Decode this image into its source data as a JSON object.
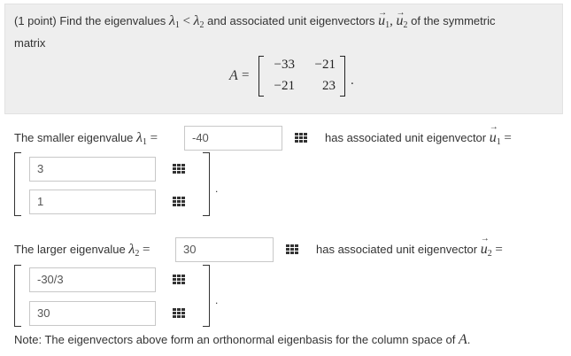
{
  "problem": {
    "points": "(1 point)",
    "text_find": "Find the eigenvalues",
    "lambda1": "λ",
    "sub1": "1",
    "lt": "<",
    "lambda2": "λ",
    "sub2": "2",
    "text_and": "and associated unit eigenvectors",
    "u1": "u",
    "u2": "u",
    "comma": ",",
    "text_of": "of the symmetric",
    "text_matrix": "matrix"
  },
  "matrix": {
    "name": "A",
    "eq": "=",
    "rows": [
      [
        "−33",
        "−21"
      ],
      [
        "−21",
        "23"
      ]
    ],
    "period": "."
  },
  "smaller": {
    "label": "The smaller eigenvalue",
    "sym": "λ",
    "sub": "1",
    "eq": "=",
    "value": "-40",
    "vector_label": "has associated unit eigenvector",
    "vec_sym": "u",
    "vec_sub": "1",
    "vec_eq": "=",
    "components": [
      "3",
      "1"
    ]
  },
  "larger": {
    "label": "The larger eigenvalue",
    "sym": "λ",
    "sub": "2",
    "eq": "=",
    "value": "30",
    "vector_label": "has associated unit eigenvector",
    "vec_sym": "u",
    "vec_sub": "2",
    "vec_eq": "=",
    "components": [
      "-30/3",
      "30"
    ]
  },
  "note": {
    "text": "Note: The eigenvectors above form an orthonormal eigenbasis for the column space of",
    "sym": "A",
    "period": "."
  },
  "icons": {
    "equation_editor": "equation-editor-grid-icon"
  },
  "colors": {
    "panel_bg": "#eeeeee",
    "text": "#333333",
    "input_border": "#c8c8c8"
  }
}
